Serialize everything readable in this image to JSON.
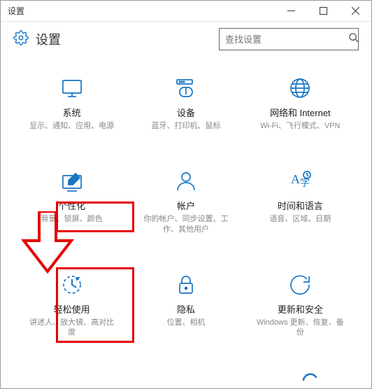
{
  "window": {
    "title": "设置"
  },
  "header": {
    "title": "设置"
  },
  "search": {
    "placeholder": "查找设置"
  },
  "tiles": {
    "system": {
      "title": "系统",
      "sub": "显示、通知、应用、电源"
    },
    "devices": {
      "title": "设备",
      "sub": "蓝牙、打印机、鼠标"
    },
    "network": {
      "title": "网络和 Internet",
      "sub": "Wi-Fi、飞行模式、VPN"
    },
    "personalization": {
      "title": "个性化",
      "sub": "背景、锁屏、颜色"
    },
    "accounts": {
      "title": "帐户",
      "sub": "你的帐户、同步设置、工作、其他用户"
    },
    "time": {
      "title": "时间和语言",
      "sub": "语音、区域、日期"
    },
    "ease": {
      "title": "轻松使用",
      "sub": "讲述人、放大镜、高对比度"
    },
    "privacy": {
      "title": "隐私",
      "sub": "位置、相机"
    },
    "update": {
      "title": "更新和安全",
      "sub": "Windows 更新、恢复、备份"
    }
  }
}
